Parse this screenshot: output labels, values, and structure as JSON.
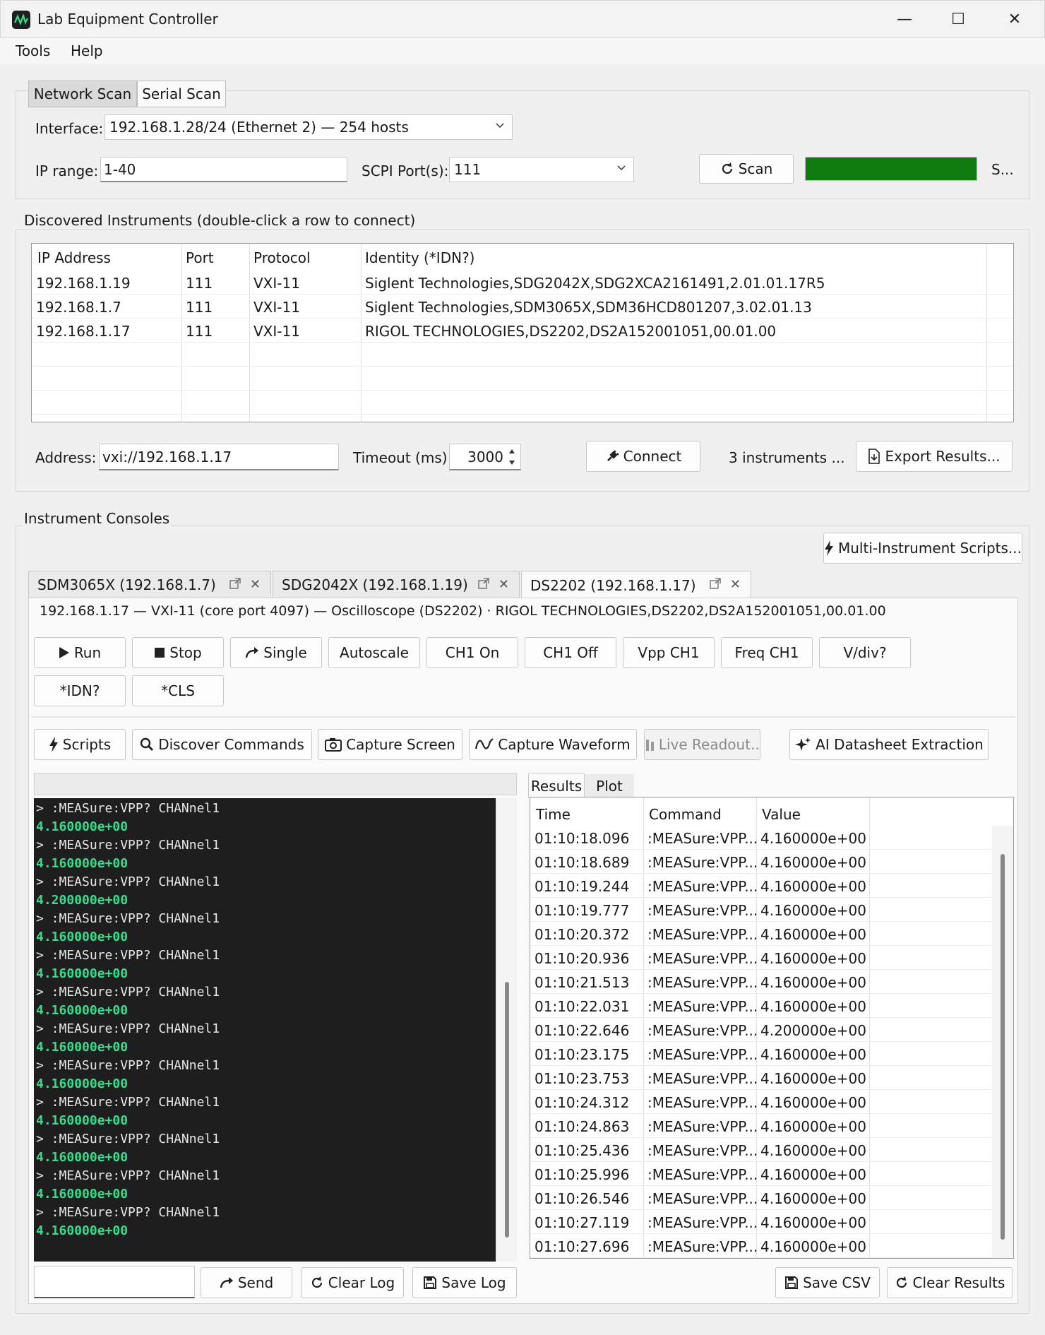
{
  "window": {
    "title": "Lab Equipment Controller",
    "minimize": "—",
    "maximize": "☐",
    "close": "✕"
  },
  "menu": {
    "items": [
      "Tools",
      "Help"
    ]
  },
  "scan": {
    "tabs": [
      "Network Scan",
      "Serial Scan"
    ],
    "interface_label": "Interface:",
    "interface_value": "192.168.1.28/24  (Ethernet 2)  —  254 hosts",
    "ip_range_label": "IP range:",
    "ip_range_value": "1-40",
    "scpi_label": "SCPI Port(s):",
    "scpi_value": "111",
    "scan_button": "Scan",
    "progress": 1.0,
    "status": "S..."
  },
  "discovered": {
    "title": "Discovered Instruments  (double-click a row to connect)",
    "columns": [
      "IP Address",
      "Port",
      "Protocol",
      "Identity (*IDN?)"
    ],
    "rows": [
      [
        "192.168.1.19",
        "111",
        "VXI-11",
        "Siglent Technologies,SDG2042X,SDG2XCA2161491,2.01.01.17R5"
      ],
      [
        "192.168.1.7",
        "111",
        "VXI-11",
        "Siglent Technologies,SDM3065X,SDM36HCD801207,3.02.01.13"
      ],
      [
        "192.168.1.17",
        "111",
        "VXI-11",
        "RIGOL TECHNOLOGIES,DS2202,DS2A152001051,00.01.00"
      ]
    ],
    "address_label": "Address:",
    "address_value": "vxi://192.168.1.17",
    "timeout_label": "Timeout (ms):",
    "timeout_value": "3000",
    "connect_button": "Connect",
    "count_text": "3 instruments ...",
    "export_button": "Export Results..."
  },
  "consoles": {
    "title": "Instrument Consoles",
    "multi_script_button": "Multi-Instrument Scripts...",
    "tabs": [
      "SDM3065X (192.168.1.7)",
      "SDG2042X (192.168.1.19)",
      "DS2202 (192.168.1.17)"
    ],
    "tab_close": "✕",
    "info": "192.168.1.17 — VXI-11 (core port 4097) — Oscilloscope (DS2202)  ·  RIGOL TECHNOLOGIES,DS2202,DS2A152001051,00.01.00",
    "cmd_buttons": [
      "Run",
      "Stop",
      "Single",
      "Autoscale",
      "CH1 On",
      "CH1 Off",
      "Vpp CH1",
      "Freq CH1",
      "V/div?",
      "*IDN?",
      "*CLS"
    ],
    "tool_buttons": [
      "Scripts",
      "Discover Commands",
      "Capture Screen",
      "Capture Waveform",
      "Live Readout...",
      "AI Datasheet Extraction"
    ],
    "log": [
      {
        "cmd": "> :MEASure:VPP? CHANnel1",
        "resp": "4.160000e+00"
      },
      {
        "cmd": "> :MEASure:VPP? CHANnel1",
        "resp": "4.160000e+00"
      },
      {
        "cmd": "> :MEASure:VPP? CHANnel1",
        "resp": "4.200000e+00"
      },
      {
        "cmd": "> :MEASure:VPP? CHANnel1",
        "resp": "4.160000e+00"
      },
      {
        "cmd": "> :MEASure:VPP? CHANnel1",
        "resp": "4.160000e+00"
      },
      {
        "cmd": "> :MEASure:VPP? CHANnel1",
        "resp": "4.160000e+00"
      },
      {
        "cmd": "> :MEASure:VPP? CHANnel1",
        "resp": "4.160000e+00"
      },
      {
        "cmd": "> :MEASure:VPP? CHANnel1",
        "resp": "4.160000e+00"
      },
      {
        "cmd": "> :MEASure:VPP? CHANnel1",
        "resp": "4.160000e+00"
      },
      {
        "cmd": "> :MEASure:VPP? CHANnel1",
        "resp": "4.160000e+00"
      },
      {
        "cmd": "> :MEASure:VPP? CHANnel1",
        "resp": "4.160000e+00"
      },
      {
        "cmd": "> :MEASure:VPP? CHANnel1",
        "resp": "4.160000e+00"
      }
    ],
    "send_button": "Send",
    "clear_log_button": "Clear Log",
    "save_log_button": "Save Log",
    "results_tabs": [
      "Results",
      "Plot"
    ],
    "results_columns": [
      "Time",
      "Command",
      "Value"
    ],
    "results": [
      [
        "01:10:18.096",
        ":MEASure:VPP...",
        "4.160000e+00"
      ],
      [
        "01:10:18.689",
        ":MEASure:VPP...",
        "4.160000e+00"
      ],
      [
        "01:10:19.244",
        ":MEASure:VPP...",
        "4.160000e+00"
      ],
      [
        "01:10:19.777",
        ":MEASure:VPP...",
        "4.160000e+00"
      ],
      [
        "01:10:20.372",
        ":MEASure:VPP...",
        "4.160000e+00"
      ],
      [
        "01:10:20.936",
        ":MEASure:VPP...",
        "4.160000e+00"
      ],
      [
        "01:10:21.513",
        ":MEASure:VPP...",
        "4.160000e+00"
      ],
      [
        "01:10:22.031",
        ":MEASure:VPP...",
        "4.160000e+00"
      ],
      [
        "01:10:22.646",
        ":MEASure:VPP...",
        "4.200000e+00"
      ],
      [
        "01:10:23.175",
        ":MEASure:VPP...",
        "4.160000e+00"
      ],
      [
        "01:10:23.753",
        ":MEASure:VPP...",
        "4.160000e+00"
      ],
      [
        "01:10:24.312",
        ":MEASure:VPP...",
        "4.160000e+00"
      ],
      [
        "01:10:24.863",
        ":MEASure:VPP...",
        "4.160000e+00"
      ],
      [
        "01:10:25.436",
        ":MEASure:VPP...",
        "4.160000e+00"
      ],
      [
        "01:10:25.996",
        ":MEASure:VPP...",
        "4.160000e+00"
      ],
      [
        "01:10:26.546",
        ":MEASure:VPP...",
        "4.160000e+00"
      ],
      [
        "01:10:27.119",
        ":MEASure:VPP...",
        "4.160000e+00"
      ],
      [
        "01:10:27.696",
        ":MEASure:VPP...",
        "4.160000e+00"
      ]
    ],
    "save_csv_button": "Save CSV",
    "clear_results_button": "Clear Results"
  },
  "colors": {
    "progress": "#107c10",
    "accent_green": "#2fe08a",
    "console_bg": "#1e1e1e"
  }
}
